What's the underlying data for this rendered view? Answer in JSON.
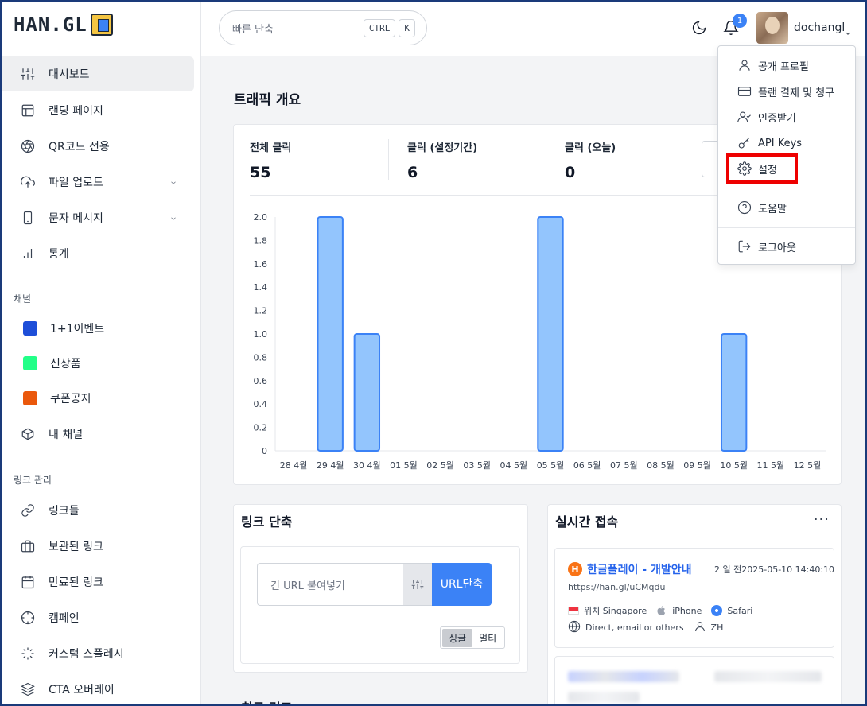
{
  "brand": {
    "logo_text": "HAN.GL"
  },
  "search": {
    "placeholder": "빠른 단축",
    "kbd1": "CTRL",
    "kbd2": "K"
  },
  "header": {
    "notif_count": "1",
    "username": "dochangl"
  },
  "sidebar": {
    "items": [
      {
        "label": "대시보드",
        "icon": "sliders-icon"
      },
      {
        "label": "랜딩 페이지",
        "icon": "layout-icon"
      },
      {
        "label": "QR코드 전용",
        "icon": "aperture-icon"
      },
      {
        "label": "파일 업로드",
        "icon": "upload-icon"
      },
      {
        "label": "문자 메시지",
        "icon": "phone-icon"
      },
      {
        "label": "통계",
        "icon": "bar-chart-icon"
      }
    ],
    "channels_title": "채널",
    "channels": [
      {
        "label": "1+1이벤트",
        "color": "#1d4ed8"
      },
      {
        "label": "신상품",
        "color": "#22ff88"
      },
      {
        "label": "쿠폰공지",
        "color": "#ea580c"
      }
    ],
    "my_channel": "내 채널",
    "links_title": "링크 관리",
    "link_items": [
      {
        "label": "링크들",
        "icon": "link-icon"
      },
      {
        "label": "보관된 링크",
        "icon": "briefcase-icon"
      },
      {
        "label": "만료된 링크",
        "icon": "calendar-icon"
      },
      {
        "label": "캠페인",
        "icon": "crosshair-icon"
      },
      {
        "label": "커스텀 스플레시",
        "icon": "loader-icon"
      },
      {
        "label": "CTA 오버레이",
        "icon": "layers-icon"
      }
    ]
  },
  "main": {
    "title": "트래픽 개요",
    "stats": [
      {
        "label": "전체 클릭",
        "value": "55"
      },
      {
        "label": "클릭 (설정기간)",
        "value": "6"
      },
      {
        "label": "클릭 (오늘)",
        "value": "0"
      }
    ]
  },
  "chart_data": {
    "type": "bar",
    "categories": [
      "28 4월",
      "29 4월",
      "30 4월",
      "01 5월",
      "02 5월",
      "03 5월",
      "04 5월",
      "05 5월",
      "06 5월",
      "07 5월",
      "08 5월",
      "09 5월",
      "10 5월",
      "11 5월",
      "12 5월"
    ],
    "values": [
      0,
      2,
      1,
      0,
      0,
      0,
      0,
      2,
      0,
      0,
      0,
      0,
      1,
      0,
      0
    ],
    "yticks": [
      "0",
      "0.2",
      "0.4",
      "0.6",
      "0.8",
      "1.0",
      "1.2",
      "1.4",
      "1.6",
      "1.8",
      "2.0"
    ],
    "ylim": [
      0,
      2
    ],
    "bar_color": "#93c5fd",
    "bar_border": "#3b82f6"
  },
  "shorten": {
    "title": "링크 단축",
    "placeholder": "긴 URL 붙여넣기",
    "button": "URL단축",
    "toggle_single": "싱글",
    "toggle_multi": "멀티"
  },
  "realtime": {
    "title": "실시간 접속",
    "more": "···",
    "visit": {
      "title": "한글플레이 - 개발안내",
      "time": "2 일 전2025-05-10 14:40:10",
      "url": "https://han.gl/uCMqdu",
      "location": "위치 Singapore",
      "device": "iPhone",
      "browser": "Safari",
      "referrer": "Direct, email or others",
      "lang": "ZH"
    }
  },
  "recent": {
    "title": "최근 링크"
  },
  "dropdown": {
    "items": [
      {
        "label": "공개 프로필",
        "icon": "user-icon"
      },
      {
        "label": "플랜 결제 및 청구",
        "icon": "credit-card-icon"
      },
      {
        "label": "인증받기",
        "icon": "user-check-icon"
      },
      {
        "label": "API Keys",
        "icon": "key-icon"
      },
      {
        "label": "설정",
        "icon": "gear-icon"
      },
      {
        "label": "도움말",
        "icon": "help-icon"
      },
      {
        "label": "로그아웃",
        "icon": "logout-icon"
      }
    ]
  }
}
